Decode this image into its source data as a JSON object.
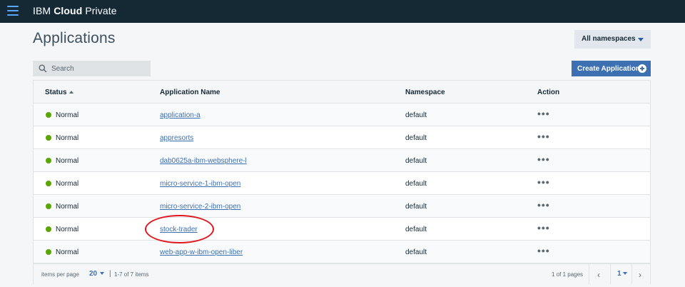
{
  "app": {
    "brand_prefix": "IBM ",
    "brand_bold": "Cloud",
    "brand_suffix": " Private",
    "menu_icon": "hamburger-icon"
  },
  "page": {
    "title": "Applications",
    "namespace_select": "All namespaces"
  },
  "search": {
    "placeholder": "Search",
    "value": "",
    "icon": "search-icon"
  },
  "create_button": {
    "label": "Create Application",
    "icon": "plus-circle-icon"
  },
  "table": {
    "columns": [
      "Status",
      "Application Name",
      "Namespace",
      "Action"
    ],
    "sorted_column": "Status",
    "sort_direction": "ascending",
    "rows": [
      {
        "status": "Normal",
        "name": "application-a",
        "namespace": "default",
        "action": "•••"
      },
      {
        "status": "Normal",
        "name": "appresorts",
        "namespace": "default",
        "action": "•••"
      },
      {
        "status": "Normal",
        "name": "dab0625a-ibm-websphere-l",
        "namespace": "default",
        "action": "•••"
      },
      {
        "status": "Normal",
        "name": "micro-service-1-ibm-open",
        "namespace": "default",
        "action": "•••"
      },
      {
        "status": "Normal",
        "name": "micro-service-2-ibm-open",
        "namespace": "default",
        "action": "•••"
      },
      {
        "status": "Normal",
        "name": "stock-trader",
        "namespace": "default",
        "action": "•••"
      },
      {
        "status": "Normal",
        "name": "web-app-w-ibm-open-liber",
        "namespace": "default",
        "action": "•••"
      }
    ],
    "status_color": "#5aa700",
    "highlighted_row": "stock-trader",
    "highlight_color": "#e0171e"
  },
  "pagination": {
    "items_per_page_label": "items per page",
    "items_per_page": "20",
    "range_text": "1-7 of 7 items",
    "separator": "|",
    "pages_text": "1 of 1 pages",
    "current_page": "1",
    "prev_icon": "chevron-left-icon",
    "next_icon": "chevron-right-icon"
  },
  "colors": {
    "topbar": "#152935",
    "accent": "#3d70b2",
    "status_normal": "#5aa700"
  }
}
